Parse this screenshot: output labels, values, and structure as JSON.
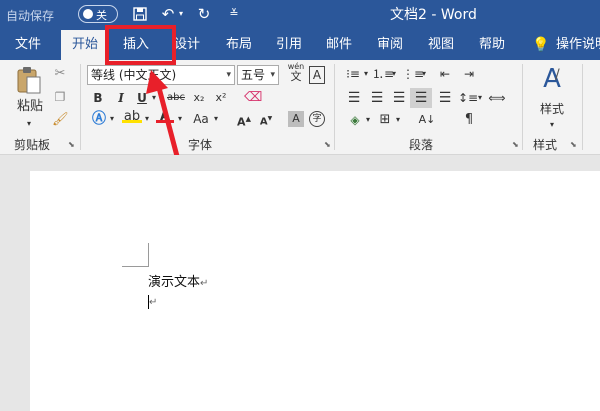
{
  "titlebar": {
    "autosave_label": "自动保存",
    "autosave_state": "关",
    "document_title": "文档2 - Word",
    "icons": [
      "save-icon",
      "undo-icon",
      "redo-icon",
      "customize-icon"
    ]
  },
  "tabs": [
    {
      "label": "文件"
    },
    {
      "label": "开始",
      "active": true
    },
    {
      "label": "插入",
      "highlighted": true
    },
    {
      "label": "设计"
    },
    {
      "label": "布局"
    },
    {
      "label": "引用"
    },
    {
      "label": "邮件"
    },
    {
      "label": "审阅"
    },
    {
      "label": "视图"
    },
    {
      "label": "帮助"
    },
    {
      "label": "操作说明"
    }
  ],
  "ribbon": {
    "clipboard": {
      "paste_label": "粘贴",
      "group_label": "剪贴板"
    },
    "font": {
      "font_name": "等线 (中文正文)",
      "font_size": "五号",
      "bold": "B",
      "italic": "I",
      "underline": "U",
      "strike": "abc",
      "subscript": "x₂",
      "superscript": "x²",
      "change_case": "Aa",
      "group_label": "字体",
      "wen": "wén",
      "char_border": "A",
      "char_shade": "A",
      "enclose": "字"
    },
    "paragraph": {
      "group_label": "段落"
    },
    "styles": {
      "label": "样式",
      "group_label": "样式"
    }
  },
  "document": {
    "text": "演示文本",
    "paragraph_mark": "↵"
  },
  "colors": {
    "brand": "#2b579a",
    "highlight_box": "#e8202a"
  }
}
